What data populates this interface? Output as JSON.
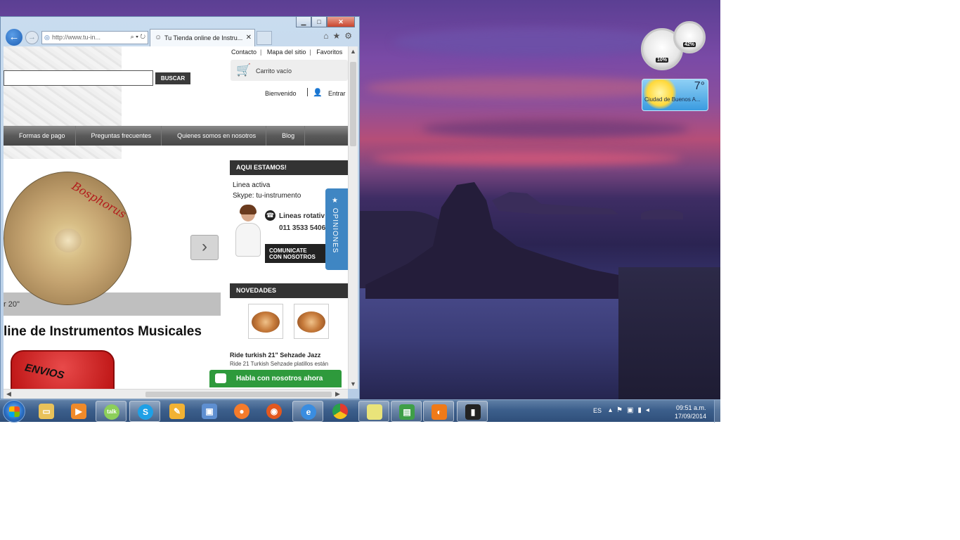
{
  "gadgets": {
    "meter_left": "10%",
    "meter_right": "42%",
    "weather_temp": "7°",
    "weather_city": "Ciudad de Buenos A..."
  },
  "browser": {
    "address": "http://www.tu-in...",
    "tab_title": "Tu Tienda online de Instru...",
    "page": {
      "top_links": [
        "Contacto",
        "Mapa del sitio",
        "Favoritos"
      ],
      "search_button": "BUSCAR",
      "cart_text": "Carrito vacío",
      "welcome": "Bienvenido",
      "login": "Entrar",
      "nav": [
        "Formas de pago",
        "Preguntas frecuentes",
        "Quienes somos en nosotros",
        "Blog"
      ],
      "slide_caption": "r 20\"",
      "heading": "line de Instrumentos Musicales",
      "envios": "ENVIOS",
      "aqui_estamos": "AQUI ESTAMOS!",
      "linea_activa": "Linea activa",
      "skype": "Skype: tu-instrumento",
      "lineas": "Lineas rotativ",
      "telefono": "011 3533 5406",
      "comunicate_1": "COMUNICATE",
      "comunicate_2": "CON NOSOTROS",
      "opiniones": "★ OPINIONES",
      "novedades": "NOVEDADES",
      "ride_title": "Ride turkish 21\" Sehzade Jazz",
      "ride_desc": "Ride 21 Turkish Sehzade platillos están",
      "chat": "Habla con nosotros ahora"
    }
  },
  "taskbar": {
    "language": "ES",
    "time": "09:51 a.m.",
    "date": "17/09/2014"
  }
}
